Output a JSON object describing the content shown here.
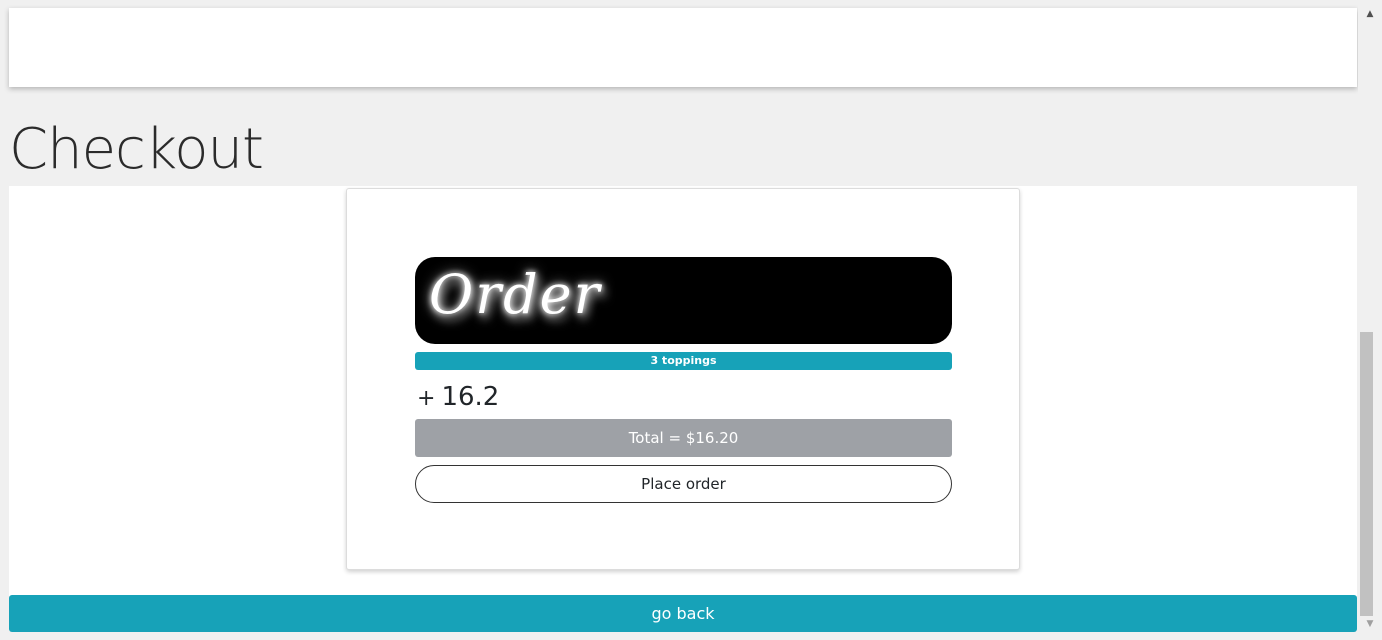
{
  "page": {
    "title": "Checkout"
  },
  "order_card": {
    "banner_text": "Order",
    "toppings_label": "3 toppings",
    "price_sign": "+",
    "price_value": "16.2",
    "total_label": "Total = $16.20",
    "place_order_label": "Place order"
  },
  "footer": {
    "go_back_label": "go back"
  },
  "scrollbar": {
    "up_icon": "scroll-up-arrow",
    "down_icon": "scroll-down-arrow"
  },
  "colors": {
    "accent": "#17a2b8",
    "total_bar": "#9ea1a6",
    "banner": "#000000"
  }
}
